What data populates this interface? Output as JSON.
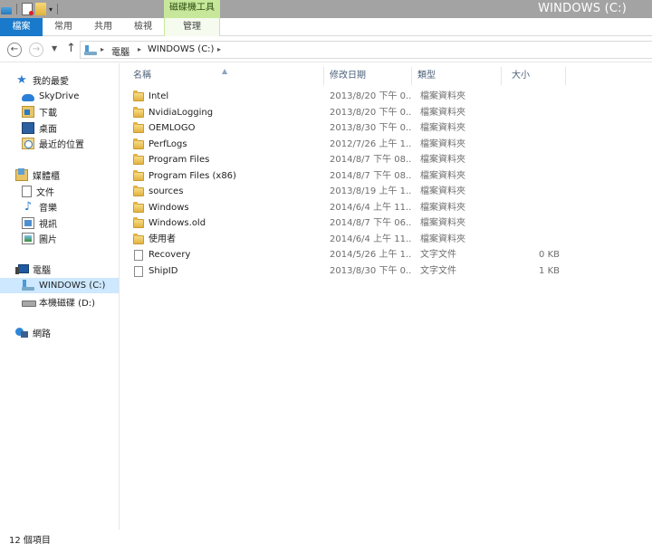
{
  "window": {
    "title": "WINDOWS (C:)",
    "context_tab_group": "磁碟機工具"
  },
  "ribbon": {
    "tabs": [
      {
        "label": "檔案"
      },
      {
        "label": "常用"
      },
      {
        "label": "共用"
      },
      {
        "label": "檢視"
      },
      {
        "label": "管理"
      }
    ]
  },
  "address": {
    "crumbs": [
      "電腦",
      "WINDOWS (C:)"
    ]
  },
  "nav_pane": {
    "favorites_label": "我的最愛",
    "favorites": [
      "SkyDrive",
      "下載",
      "桌面",
      "最近的位置"
    ],
    "libraries_label": "媒體櫃",
    "libraries": [
      "文件",
      "音樂",
      "視訊",
      "圖片"
    ],
    "computer_label": "電腦",
    "drives": [
      "WINDOWS (C:)",
      "本機磁碟 (D:)"
    ],
    "network_label": "網路"
  },
  "columns": {
    "name": "名稱",
    "date": "修改日期",
    "type": "類型",
    "size": "大小"
  },
  "files": [
    {
      "name": "Intel",
      "date": "2013/8/20 下午 0...",
      "type": "檔案資料夾",
      "size": "",
      "kind": "folder"
    },
    {
      "name": "NvidiaLogging",
      "date": "2013/8/20 下午 0...",
      "type": "檔案資料夾",
      "size": "",
      "kind": "folder"
    },
    {
      "name": "OEMLOGO",
      "date": "2013/8/30 下午 0...",
      "type": "檔案資料夾",
      "size": "",
      "kind": "folder"
    },
    {
      "name": "PerfLogs",
      "date": "2012/7/26 上午 1...",
      "type": "檔案資料夾",
      "size": "",
      "kind": "folder"
    },
    {
      "name": "Program Files",
      "date": "2014/8/7 下午 08...",
      "type": "檔案資料夾",
      "size": "",
      "kind": "folder"
    },
    {
      "name": "Program Files (x86)",
      "date": "2014/8/7 下午 08...",
      "type": "檔案資料夾",
      "size": "",
      "kind": "folder"
    },
    {
      "name": "sources",
      "date": "2013/8/19 上午 1...",
      "type": "檔案資料夾",
      "size": "",
      "kind": "folder"
    },
    {
      "name": "Windows",
      "date": "2014/6/4 上午 11...",
      "type": "檔案資料夾",
      "size": "",
      "kind": "folder"
    },
    {
      "name": "Windows.old",
      "date": "2014/8/7 下午 06...",
      "type": "檔案資料夾",
      "size": "",
      "kind": "folder"
    },
    {
      "name": "使用者",
      "date": "2014/6/4 上午 11...",
      "type": "檔案資料夾",
      "size": "",
      "kind": "folder"
    },
    {
      "name": "Recovery",
      "date": "2014/5/26 上午 1...",
      "type": "文字文件",
      "size": "0 KB",
      "kind": "file"
    },
    {
      "name": "ShipID",
      "date": "2013/8/30 下午 0...",
      "type": "文字文件",
      "size": "1 KB",
      "kind": "file"
    }
  ],
  "status": {
    "item_count": "12 個項目"
  }
}
